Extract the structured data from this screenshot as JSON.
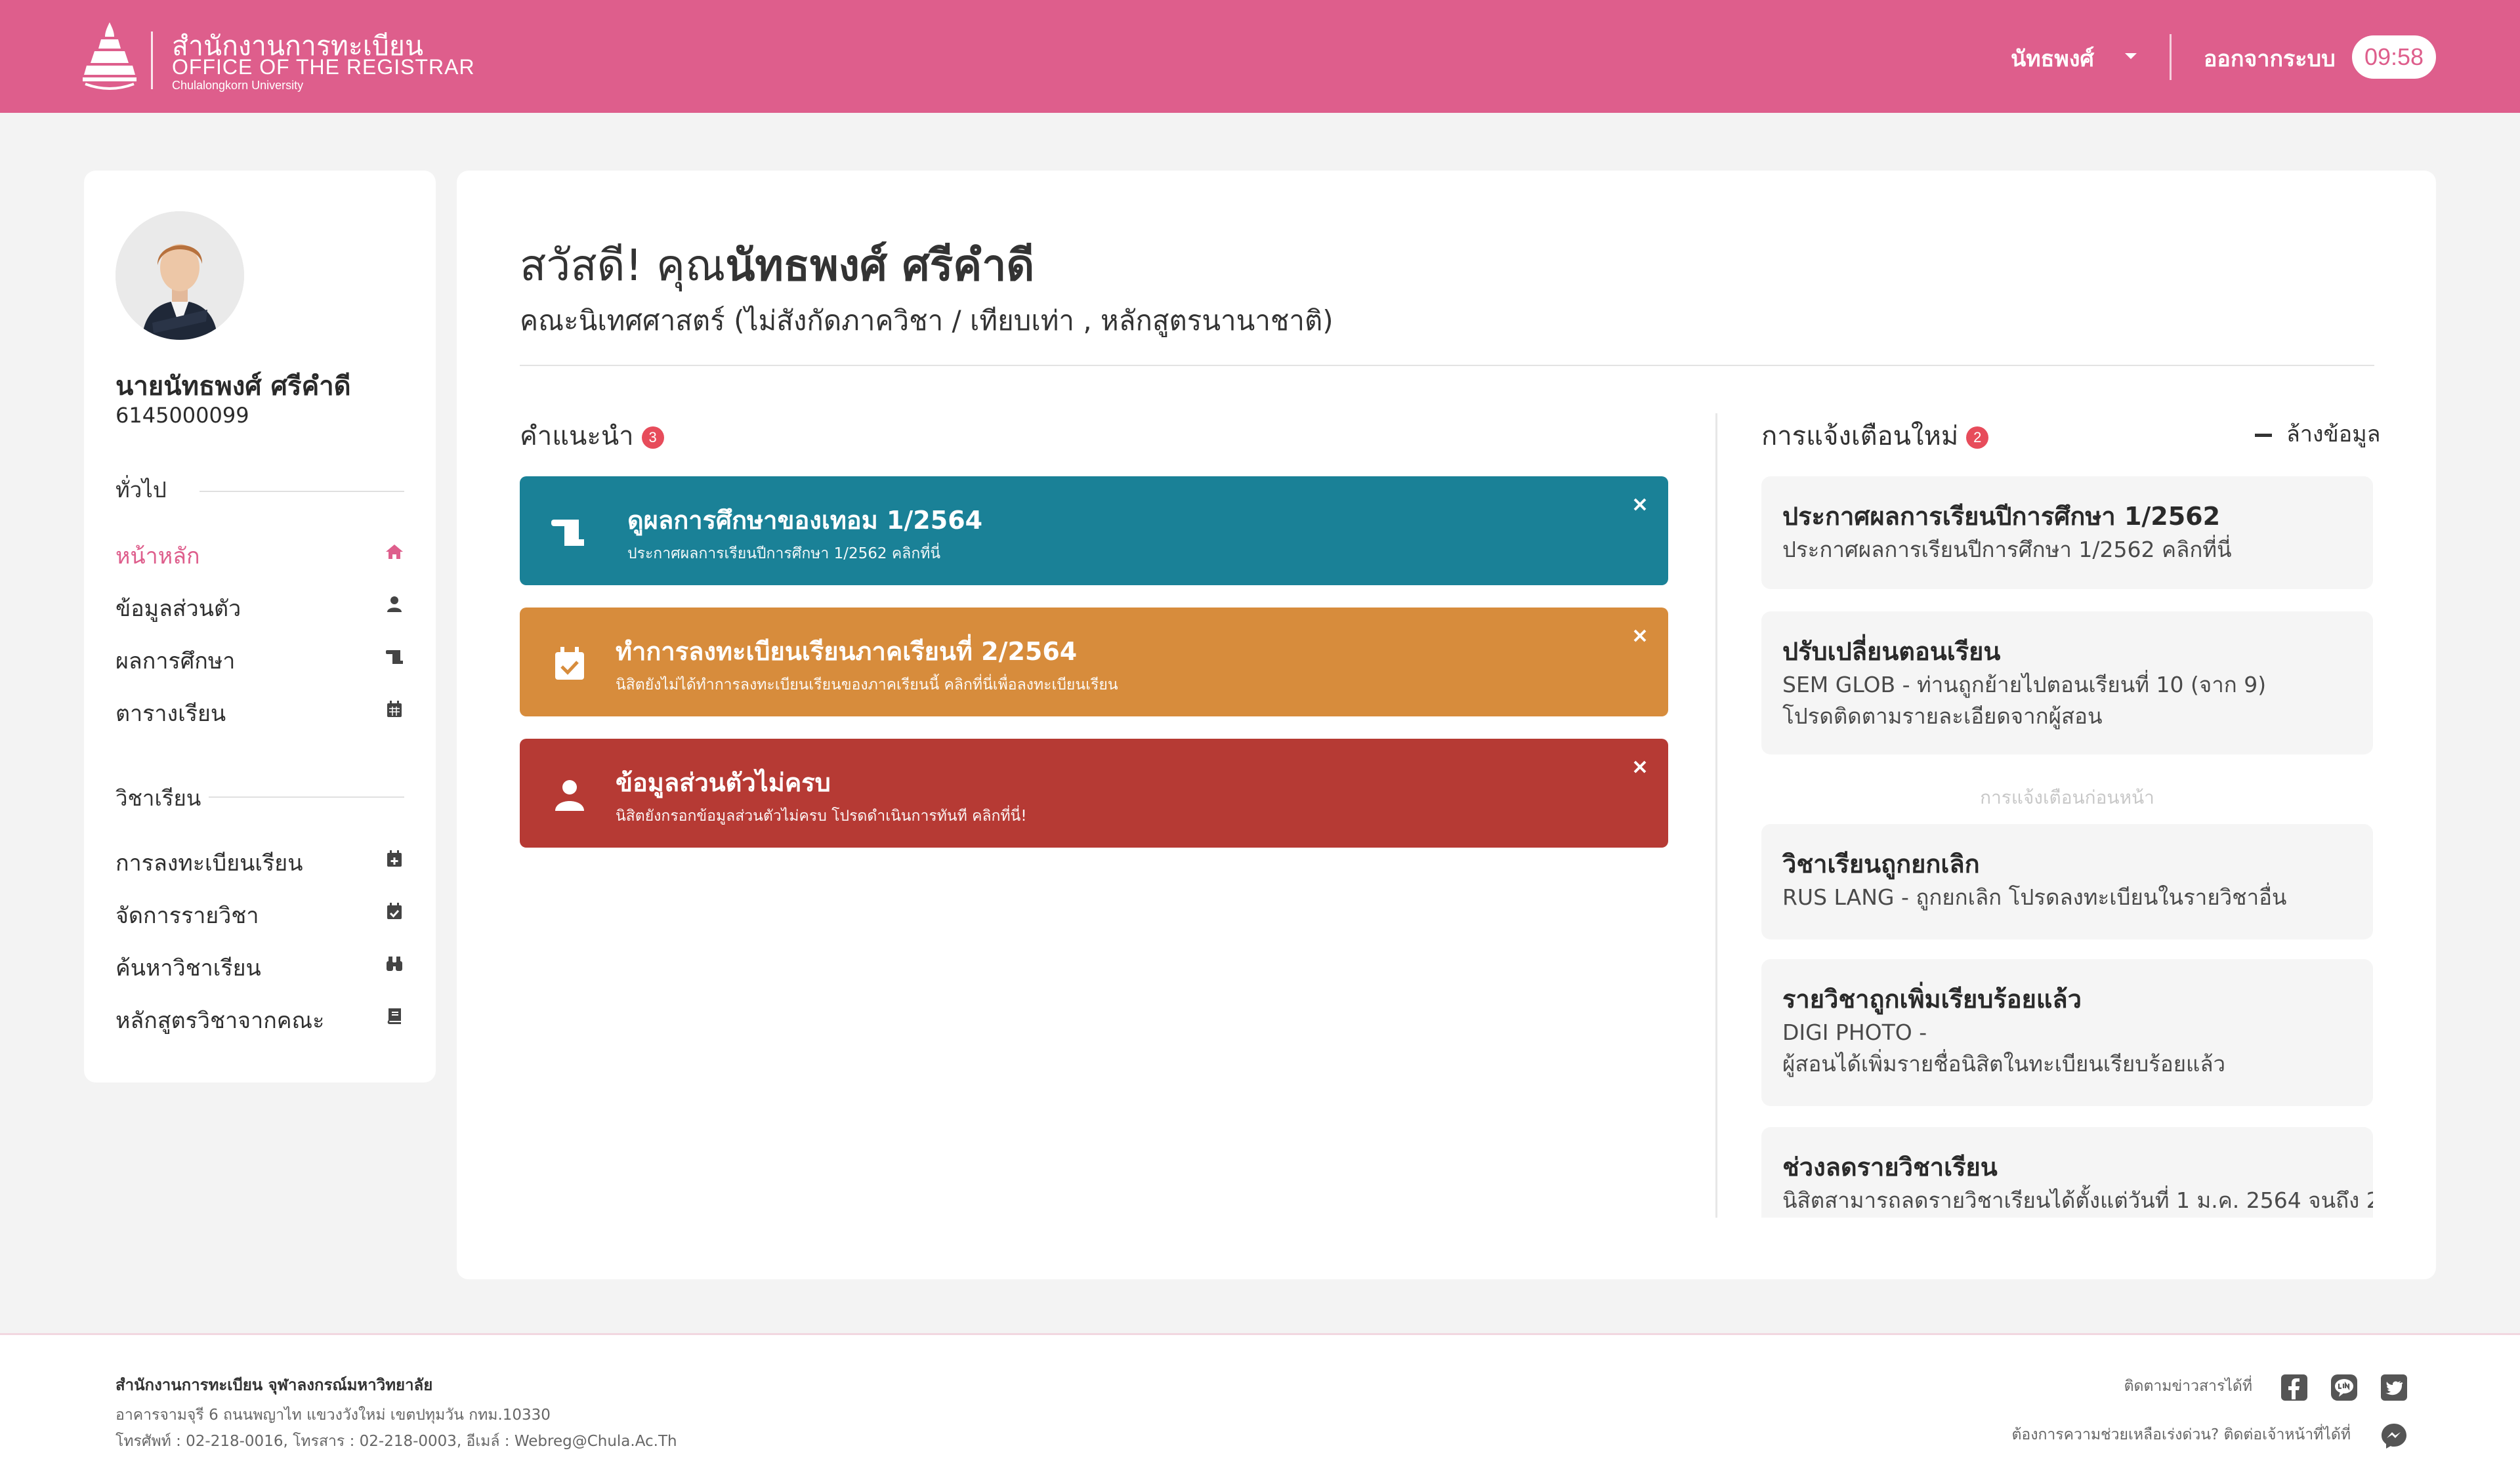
{
  "header": {
    "brand_th": "สำนักงานการทะเบียน",
    "brand_en": "OFFICE OF THE REGISTRAR",
    "brand_sub": "Chulalongkorn University",
    "user_menu": "นัทธพงศ์",
    "logout": "ออกจากระบบ",
    "timer": "09:58",
    "brand_color": "#de5e8c"
  },
  "sidebar": {
    "full_name": "นายนัทธพงศ์ ศรีคำดี",
    "student_id": "6145000099",
    "section_general": "ทั่วไป",
    "section_courses": "วิชาเรียน",
    "items": [
      {
        "label": "หน้าหลัก",
        "icon": "home-icon",
        "active": true
      },
      {
        "label": "ข้อมูลส่วนตัว",
        "icon": "user-icon",
        "active": false
      },
      {
        "label": "ผลการศึกษา",
        "icon": "scroll-icon",
        "active": false
      },
      {
        "label": "ตารางเรียน",
        "icon": "calendar-icon",
        "active": false
      },
      {
        "label": "การลงทะเบียนเรียน",
        "icon": "calendar-plus-icon",
        "active": false
      },
      {
        "label": "จัดการรายวิชา",
        "icon": "calendar-check-icon",
        "active": false
      },
      {
        "label": "ค้นหาวิชาเรียน",
        "icon": "binoculars-icon",
        "active": false
      },
      {
        "label": "หลักสูตรวิชาจากคณะ",
        "icon": "book-icon",
        "active": false
      }
    ]
  },
  "main": {
    "greeting_prefix": "สวัสดี! คุณ",
    "greeting_name": "นัทธพงศ์ ศรีคำดี",
    "faculty": "คณะนิเทศศาสตร์ (ไม่สังกัดภาควิชา / เทียบเท่า , หลักสูตรนานาชาติ)",
    "recommend_title": "คำแนะนำ",
    "recommend_count": "3",
    "recommendations": [
      {
        "title": "ดูผลการศึกษาของเทอม 1/2564",
        "subtitle": "ประกาศผลการเรียนปีการศึกษา 1/2562 คลิกที่นี่",
        "color": "#1a8197",
        "icon": "scroll-icon"
      },
      {
        "title": "ทำการลงทะเบียนเรียนภาคเรียนที่ 2/2564",
        "subtitle": "นิสิตยังไม่ได้ทำการลงทะเบียนเรียนของภาคเรียนนี้ คลิกที่นี่เพื่อลงทะเบียนเรียน",
        "color": "#d78c3c",
        "icon": "calendar-check-icon"
      },
      {
        "title": "ข้อมูลส่วนตัวไม่ครบ",
        "subtitle": "นิสิตยังกรอกข้อมูลส่วนตัวไม่ครบ โปรดดำเนินการทันที คลิกที่นี่!",
        "color": "#b63a34",
        "icon": "user-icon"
      }
    ],
    "notifications_title": "การแจ้งเตือนใหม่",
    "notifications_count": "2",
    "clear_label": "ล้างข้อมูล",
    "previous_label": "การแจ้งเตือนก่อนหน้า",
    "notifications": [
      {
        "title": "ประกาศผลการเรียนปีการศึกษา 1/2562",
        "lines": [
          "ประกาศผลการเรียนปีการศึกษา 1/2562 คลิกที่นี่"
        ]
      },
      {
        "title": "ปรับเปลี่ยนตอนเรียน",
        "lines": [
          "SEM GLOB - ท่านถูกย้ายไปตอนเรียนที่ 10 (จาก 9)",
          "โปรดติดตามรายละเอียดจากผู้สอน"
        ]
      },
      {
        "title": "วิชาเรียนถูกยกเลิก",
        "lines": [
          "RUS LANG - ถูกยกเลิก โปรดลงทะเบียนในรายวิชาอื่น"
        ]
      },
      {
        "title": "รายวิชาถูกเพิ่มเรียบร้อยแล้ว",
        "lines": [
          "DIGI PHOTO -",
          "ผู้สอนได้เพิ่มรายชื่อนิสิตในทะเบียนเรียบร้อยแล้ว"
        ]
      },
      {
        "title": "ช่วงลดรายวิชาเรียน",
        "lines": [
          "นิสิตสามารถลดรายวิชาเรียนได้ตั้งแต่วันที่ 1 ม.ค. 2564 จนถึง 2"
        ]
      }
    ]
  },
  "footer": {
    "org": "สำนักงานการทะเบียน จุฬาลงกรณ์มหาวิทยาลัย",
    "address": "อาคารจามจุรี 6 ถนนพญาไท แขวงวังใหม่ เขตปทุมวัน กทม.10330",
    "contact": "โทรศัพท์ : 02-218-0016, โทรสาร : 02-218-0003, อีเมล์ : Webreg@Chula.Ac.Th",
    "follow": "ติดตามข่าวสารได้ที่",
    "help": "ต้องการความช่วยเหลือเร่งด่วน? ติดต่อเจ้าหน้าที่ได้ที่"
  }
}
